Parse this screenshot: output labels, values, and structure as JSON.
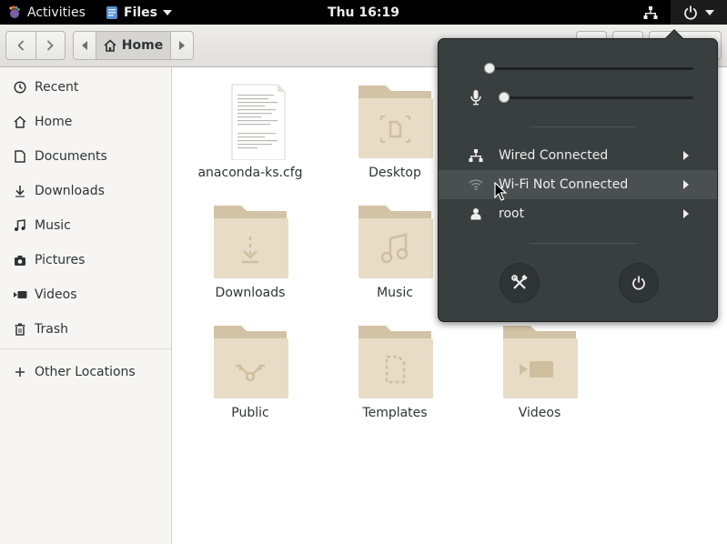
{
  "topbar": {
    "activities_label": "Activities",
    "app_menu_label": "Files",
    "clock": "Thu 16:19",
    "icons": {
      "activities": "gnome-foot-icon",
      "app": "files-app-icon",
      "network": "wired-network-icon",
      "power": "power-icon",
      "menu_arrow": "caret-down-icon"
    }
  },
  "headerbar": {
    "path": {
      "current": "Home"
    }
  },
  "sidebar": {
    "items": [
      {
        "label": "Recent",
        "icon": "clock-icon"
      },
      {
        "label": "Home",
        "icon": "home-icon"
      },
      {
        "label": "Documents",
        "icon": "document-icon"
      },
      {
        "label": "Downloads",
        "icon": "download-icon"
      },
      {
        "label": "Music",
        "icon": "music-note-icon"
      },
      {
        "label": "Pictures",
        "icon": "camera-icon"
      },
      {
        "label": "Videos",
        "icon": "video-camera-icon"
      },
      {
        "label": "Trash",
        "icon": "trash-icon"
      },
      {
        "label": "Other Locations",
        "icon": "plus-icon"
      }
    ]
  },
  "files": [
    {
      "name": "anaconda-ks.cfg",
      "type": "text-file"
    },
    {
      "name": "Desktop",
      "type": "folder-desktop"
    },
    {
      "name": "Downloads",
      "type": "folder-downloads"
    },
    {
      "name": "Music",
      "type": "folder-music"
    },
    {
      "name": "Public",
      "type": "folder-public"
    },
    {
      "name": "Templates",
      "type": "folder-templates"
    },
    {
      "name": "Videos",
      "type": "folder-videos"
    }
  ],
  "system_menu": {
    "volume_level": 0.0,
    "microphone_level": 0.0,
    "items": [
      {
        "label": "Wired Connected",
        "icon": "wired-network-icon"
      },
      {
        "label": "Wi-Fi Not Connected",
        "icon": "wifi-icon"
      },
      {
        "label": "root",
        "icon": "user-icon"
      }
    ],
    "buttons": [
      {
        "name": "settings",
        "icon": "settings-tools-icon"
      },
      {
        "name": "power",
        "icon": "power-icon"
      }
    ]
  },
  "colors": {
    "topbar_bg": "#000000",
    "popover_bg": "#393f3f",
    "folder": "#e8dcc6",
    "folder_tab": "#d3c3a6",
    "sidebar_bg": "#f6f5f4"
  }
}
